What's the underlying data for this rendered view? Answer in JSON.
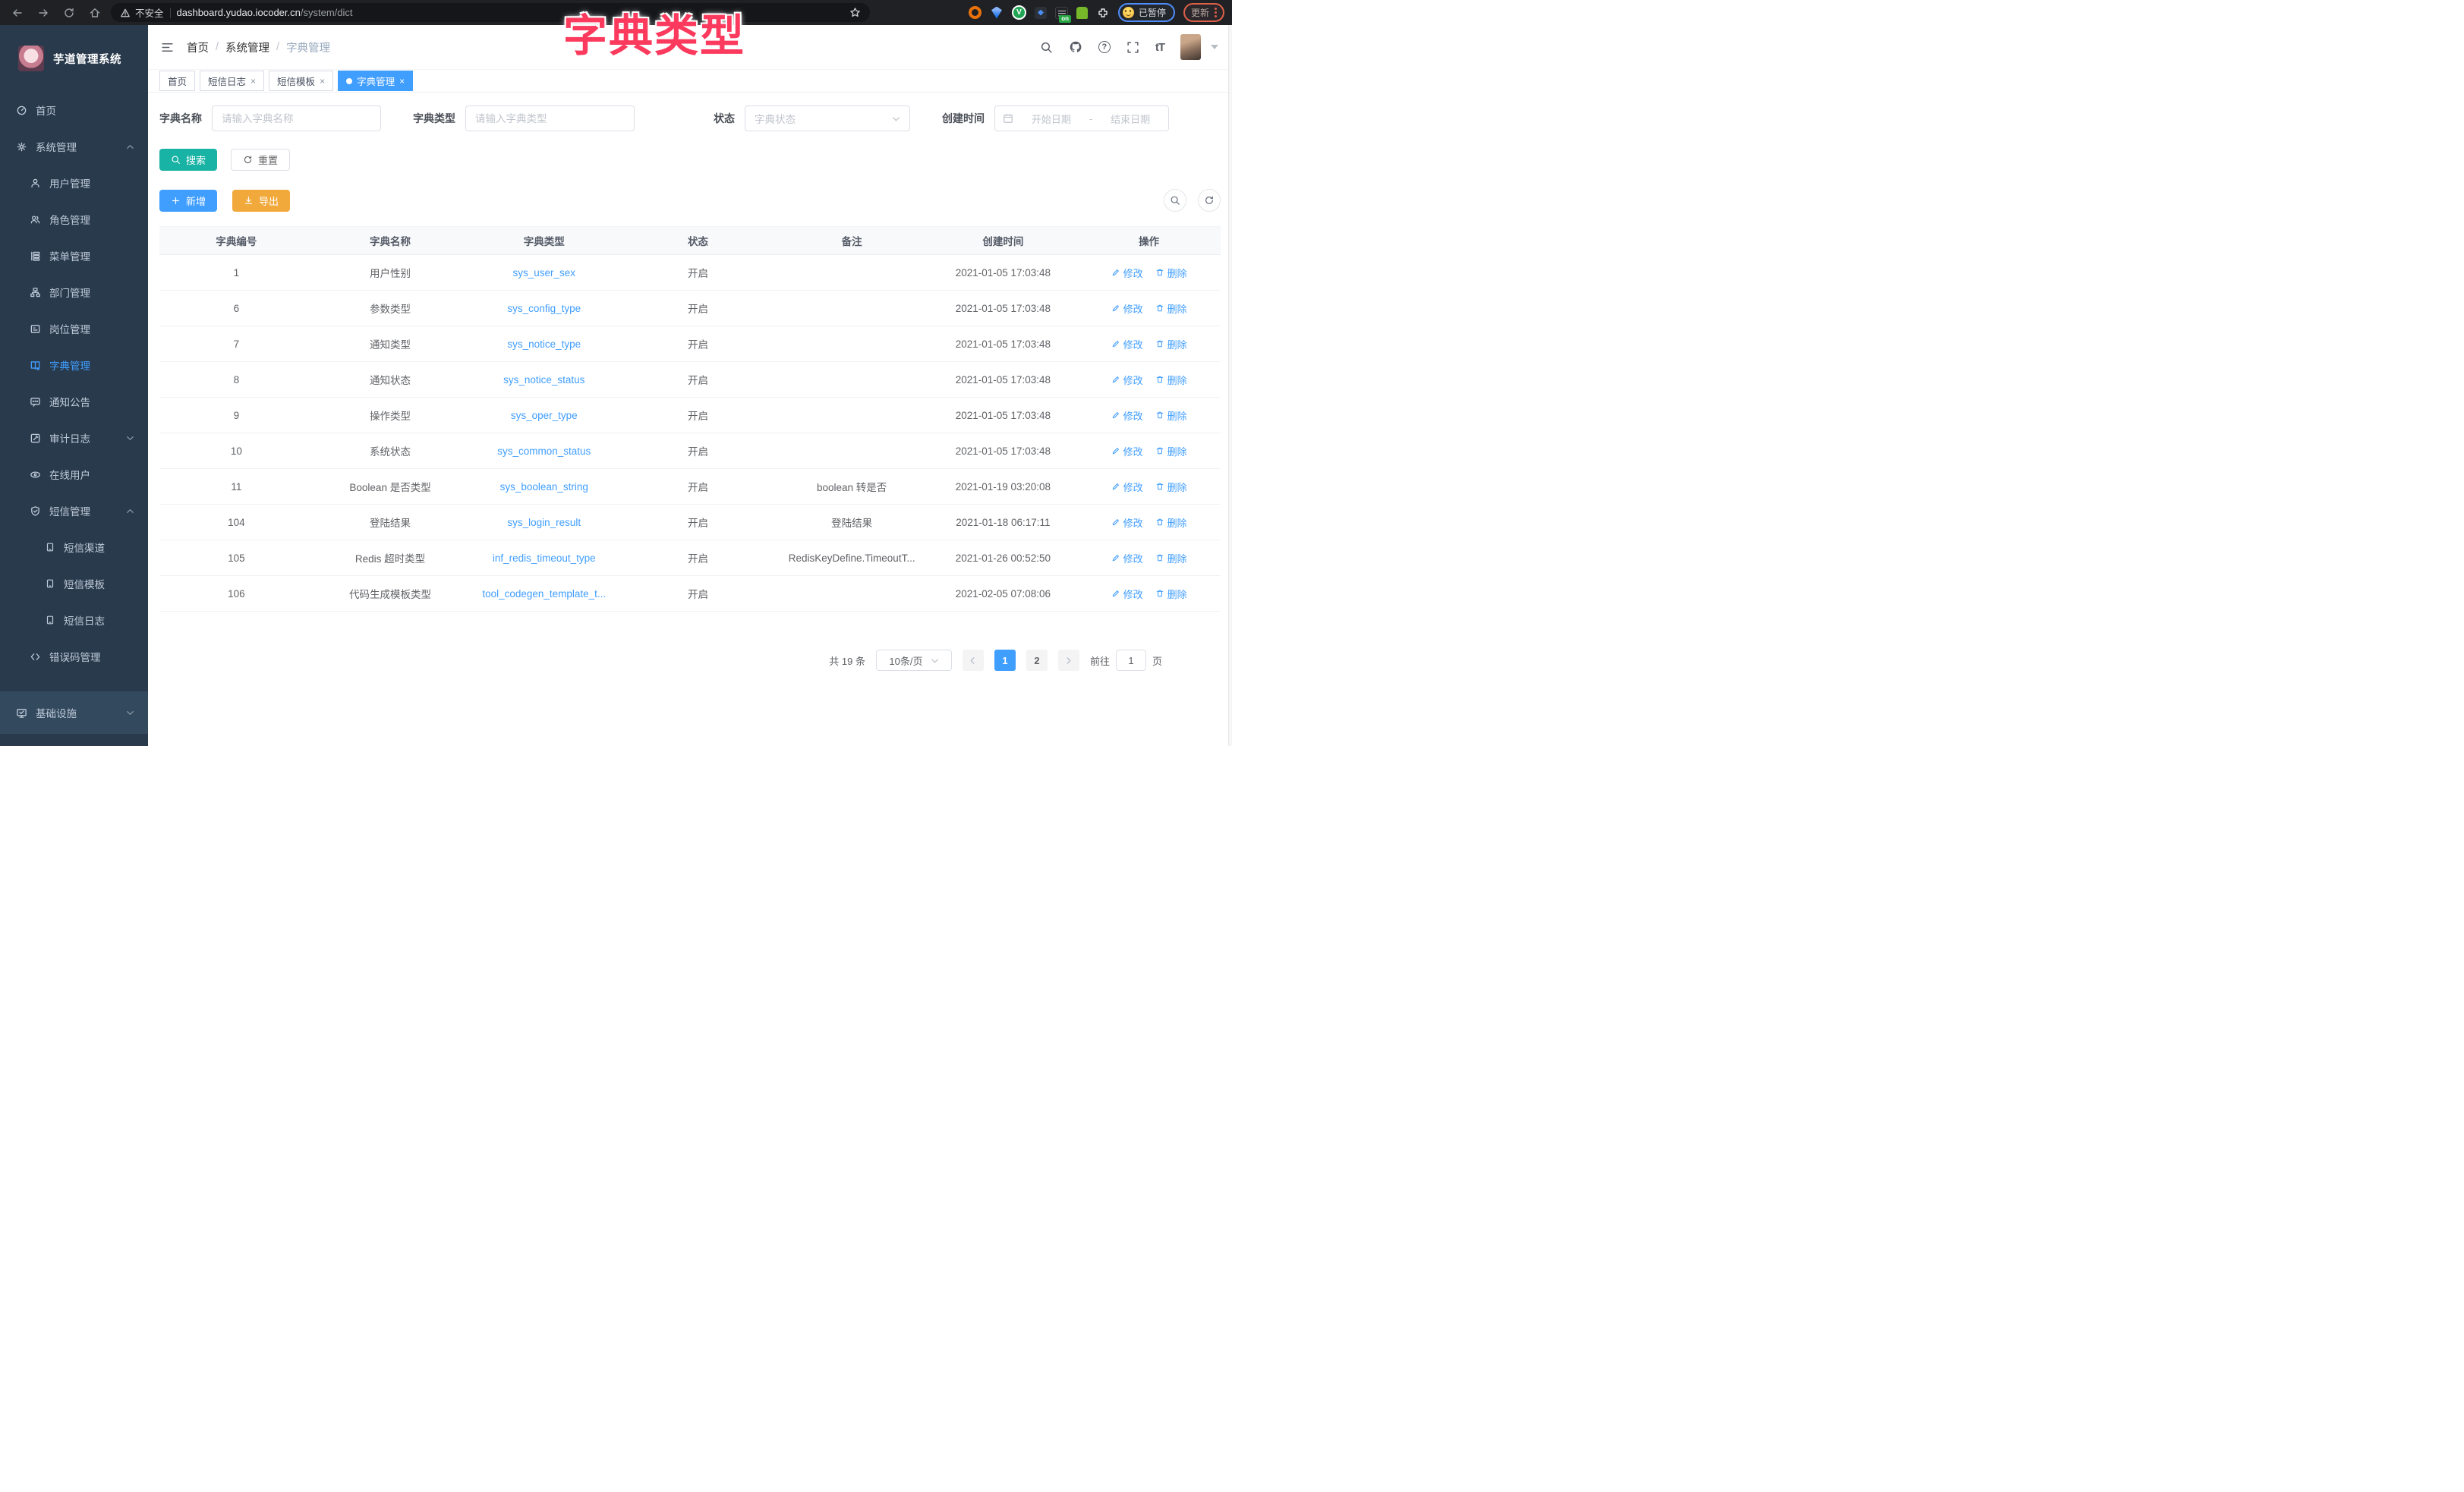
{
  "colors": {
    "accent": "#409eff",
    "search_button": "#18b3a4",
    "export_button": "#f2a93c",
    "add_button": "#409eff",
    "overlay_pink": "#fb3a5d",
    "sidebar_bg": "#293a4d",
    "active_tab": "#409eff"
  },
  "icons": {
    "help": "?",
    "font_size": "tT",
    "close": "×",
    "v_ext": "V"
  },
  "overlay": {
    "text": "字典类型"
  },
  "browser": {
    "security_label": "不安全",
    "url_domain": "dashboard.yudao.iocoder.cn",
    "url_path": "/system/dict",
    "on_badge": "on",
    "paused_badge": "已暂停",
    "update_button": "更新"
  },
  "sidebar": {
    "title": "芋道管理系统",
    "items": [
      {
        "label": "首页"
      },
      {
        "label": "系统管理"
      },
      {
        "label": "用户管理"
      },
      {
        "label": "角色管理"
      },
      {
        "label": "菜单管理"
      },
      {
        "label": "部门管理"
      },
      {
        "label": "岗位管理"
      },
      {
        "label": "字典管理"
      },
      {
        "label": "通知公告"
      },
      {
        "label": "审计日志"
      },
      {
        "label": "在线用户"
      },
      {
        "label": "短信管理"
      },
      {
        "label": "短信渠道"
      },
      {
        "label": "短信模板"
      },
      {
        "label": "短信日志"
      },
      {
        "label": "错误码管理"
      },
      {
        "label": "基础设施"
      }
    ]
  },
  "header": {
    "breadcrumb": [
      "首页",
      "系统管理",
      "字典管理"
    ],
    "breadcrumb_sep": "/"
  },
  "tabs": [
    {
      "label": "首页",
      "closable": false
    },
    {
      "label": "短信日志",
      "closable": true
    },
    {
      "label": "短信模板",
      "closable": true
    },
    {
      "label": "字典管理",
      "closable": true,
      "active": true
    }
  ],
  "filters": {
    "name_label": "字典名称",
    "name_placeholder": "请输入字典名称",
    "type_label": "字典类型",
    "type_placeholder": "请输入字典类型",
    "status_label": "状态",
    "status_placeholder": "字典状态",
    "date_label": "创建时间",
    "date_start": "开始日期",
    "date_sep": "-",
    "date_end": "结束日期"
  },
  "buttons": {
    "search": "搜索",
    "reset": "重置",
    "add": "新增",
    "export": "导出"
  },
  "table": {
    "columns": [
      "字典编号",
      "字典名称",
      "字典类型",
      "状态",
      "备注",
      "创建时间",
      "操作"
    ],
    "edit_label": "修改",
    "delete_label": "删除",
    "rows": [
      {
        "id": "1",
        "name": "用户性别",
        "type": "sys_user_sex",
        "status": "开启",
        "remark": "",
        "created": "2021-01-05 17:03:48"
      },
      {
        "id": "6",
        "name": "参数类型",
        "type": "sys_config_type",
        "status": "开启",
        "remark": "",
        "created": "2021-01-05 17:03:48"
      },
      {
        "id": "7",
        "name": "通知类型",
        "type": "sys_notice_type",
        "status": "开启",
        "remark": "",
        "created": "2021-01-05 17:03:48"
      },
      {
        "id": "8",
        "name": "通知状态",
        "type": "sys_notice_status",
        "status": "开启",
        "remark": "",
        "created": "2021-01-05 17:03:48"
      },
      {
        "id": "9",
        "name": "操作类型",
        "type": "sys_oper_type",
        "status": "开启",
        "remark": "",
        "created": "2021-01-05 17:03:48"
      },
      {
        "id": "10",
        "name": "系统状态",
        "type": "sys_common_status",
        "status": "开启",
        "remark": "",
        "created": "2021-01-05 17:03:48"
      },
      {
        "id": "11",
        "name": "Boolean 是否类型",
        "type": "sys_boolean_string",
        "status": "开启",
        "remark": "boolean 转是否",
        "created": "2021-01-19 03:20:08"
      },
      {
        "id": "104",
        "name": "登陆结果",
        "type": "sys_login_result",
        "status": "开启",
        "remark": "登陆结果",
        "created": "2021-01-18 06:17:11"
      },
      {
        "id": "105",
        "name": "Redis 超时类型",
        "type": "inf_redis_timeout_type",
        "status": "开启",
        "remark": "RedisKeyDefine.TimeoutT...",
        "created": "2021-01-26 00:52:50"
      },
      {
        "id": "106",
        "name": "代码生成模板类型",
        "type": "tool_codegen_template_t...",
        "status": "开启",
        "remark": "",
        "created": "2021-02-05 07:08:06"
      }
    ]
  },
  "pagination": {
    "total": "共 19 条",
    "page_size": "10条/页",
    "page1": "1",
    "page2": "2",
    "current": "1",
    "goto_label": "前往",
    "goto_value": "1",
    "page_label": "页"
  }
}
